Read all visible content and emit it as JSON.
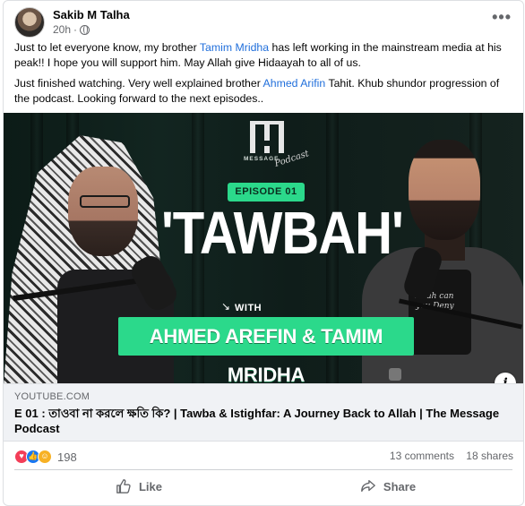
{
  "post": {
    "author": "Sakib M Talha",
    "time": "20h",
    "privacy_icon": "globe-icon",
    "more_label": "•••",
    "text": {
      "p1_before": "Just to let everyone know, my brother ",
      "p1_mention": "Tamim Mridha",
      "p1_after": " has left working in the mainstream media at his peak!! I hope you will support him. May Allah give Hidaayah to all of us.",
      "p2_before": "Just finished watching. Very well explained brother ",
      "p2_mention": "Ahmed Arifin",
      "p2_after": " Tahit. Khub shundor progression of the podcast. Looking forward to the next episodes.."
    }
  },
  "thumbnail": {
    "logo_sub": "MESSAGE",
    "logo_script": "Podcast",
    "episode": "EPISODE 01",
    "title": "'TAWBAH'",
    "with": "WITH",
    "guests": "AHMED AREFIN & TAMIM MRIDHA",
    "mug_text": "Allah can you Deny",
    "info_label": "i"
  },
  "link_preview": {
    "domain": "YOUTUBE.COM",
    "title": "E 01 : তাওবা না করলে ক্ষতি কি? | Tawba & Istighfar: A Journey Back to Allah | The Message Podcast"
  },
  "engagement": {
    "reaction_count": "198",
    "comments": "13 comments",
    "shares": "18 shares"
  },
  "actions": {
    "like": "Like",
    "share": "Share"
  },
  "colors": {
    "accent": "#216fdb",
    "brand_green": "#2bd98b",
    "like_blue": "#1877f2",
    "love_red": "#f33e58"
  }
}
